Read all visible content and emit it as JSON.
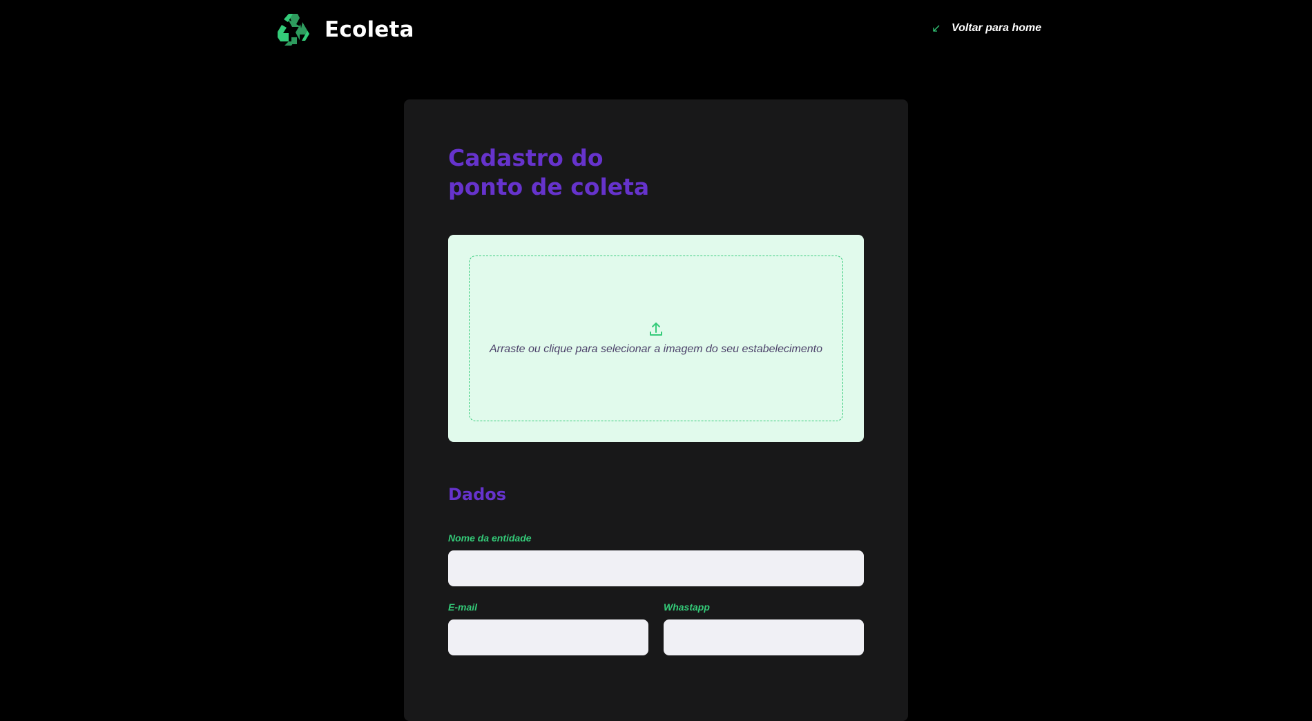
{
  "header": {
    "brand": "Ecoleta",
    "back_link": "Voltar para home"
  },
  "form": {
    "title": "Cadastro do\nponto de coleta",
    "dropzone": {
      "text": "Arraste ou clique para selecionar a imagem do seu estabelecimento"
    },
    "section_title": "Dados",
    "fields": {
      "name": {
        "label": "Nome da entidade",
        "value": ""
      },
      "email": {
        "label": "E-mail",
        "value": ""
      },
      "whatsapp": {
        "label": "Whastapp",
        "value": ""
      }
    }
  },
  "colors": {
    "primary": "#6633cc",
    "accent": "#34cb79",
    "background": "#000000",
    "card": "#181819",
    "dropzone_bg": "#e1faec",
    "input_bg": "#f0f0f5"
  },
  "icons": {
    "logo": "recycle-icon",
    "back": "arrow-down-left-icon",
    "upload": "upload-icon"
  }
}
